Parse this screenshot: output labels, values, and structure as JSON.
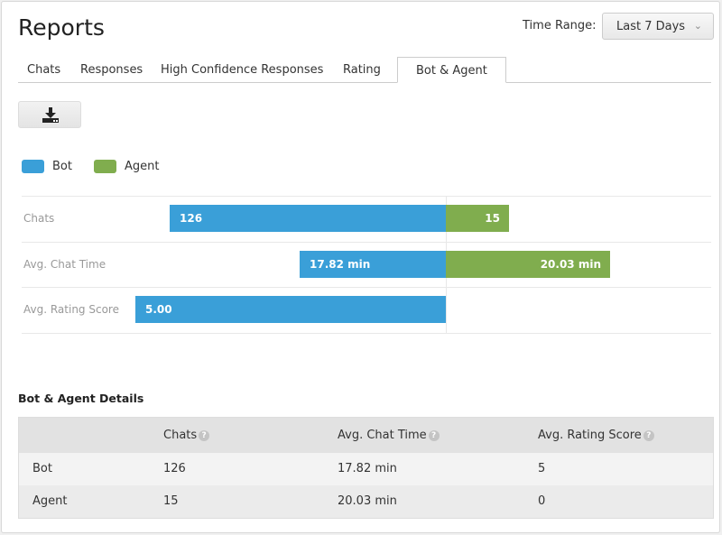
{
  "header": {
    "title": "Reports",
    "time_range_label": "Time Range:",
    "time_range_value": "Last 7 Days"
  },
  "tabs": [
    {
      "label": "Chats",
      "active": false
    },
    {
      "label": "Responses",
      "active": false
    },
    {
      "label": "High Confidence Responses",
      "active": false
    },
    {
      "label": "Rating",
      "active": false
    },
    {
      "label": "Bot & Agent",
      "active": true
    }
  ],
  "toolbar": {
    "download_icon": "download-icon"
  },
  "colors": {
    "bot": "#3a9fd8",
    "agent": "#80ad4e"
  },
  "chart_data": {
    "type": "bar",
    "orientation": "horizontal-diverging",
    "legend": [
      "Bot",
      "Agent"
    ],
    "legend_position": "top-left",
    "categories": [
      "Chats",
      "Avg. Chat Time",
      "Avg. Rating Score"
    ],
    "series": [
      {
        "name": "Bot",
        "values": [
          126,
          17.82,
          5.0
        ],
        "labels": [
          "126",
          "17.82 min",
          "5.00"
        ],
        "fill_fraction": [
          0.89,
          0.47,
          1.0
        ]
      },
      {
        "name": "Agent",
        "values": [
          15,
          20.03,
          0
        ],
        "labels": [
          "15",
          "20.03 min",
          ""
        ],
        "fill_fraction": [
          0.24,
          0.62,
          0
        ]
      }
    ]
  },
  "details": {
    "title": "Bot & Agent Details",
    "columns": [
      "",
      "Chats",
      "Avg. Chat Time",
      "Avg. Rating Score"
    ],
    "rows": [
      [
        "Bot",
        "126",
        "17.82 min",
        "5"
      ],
      [
        "Agent",
        "15",
        "20.03 min",
        "0"
      ]
    ],
    "help_icon": "?"
  }
}
